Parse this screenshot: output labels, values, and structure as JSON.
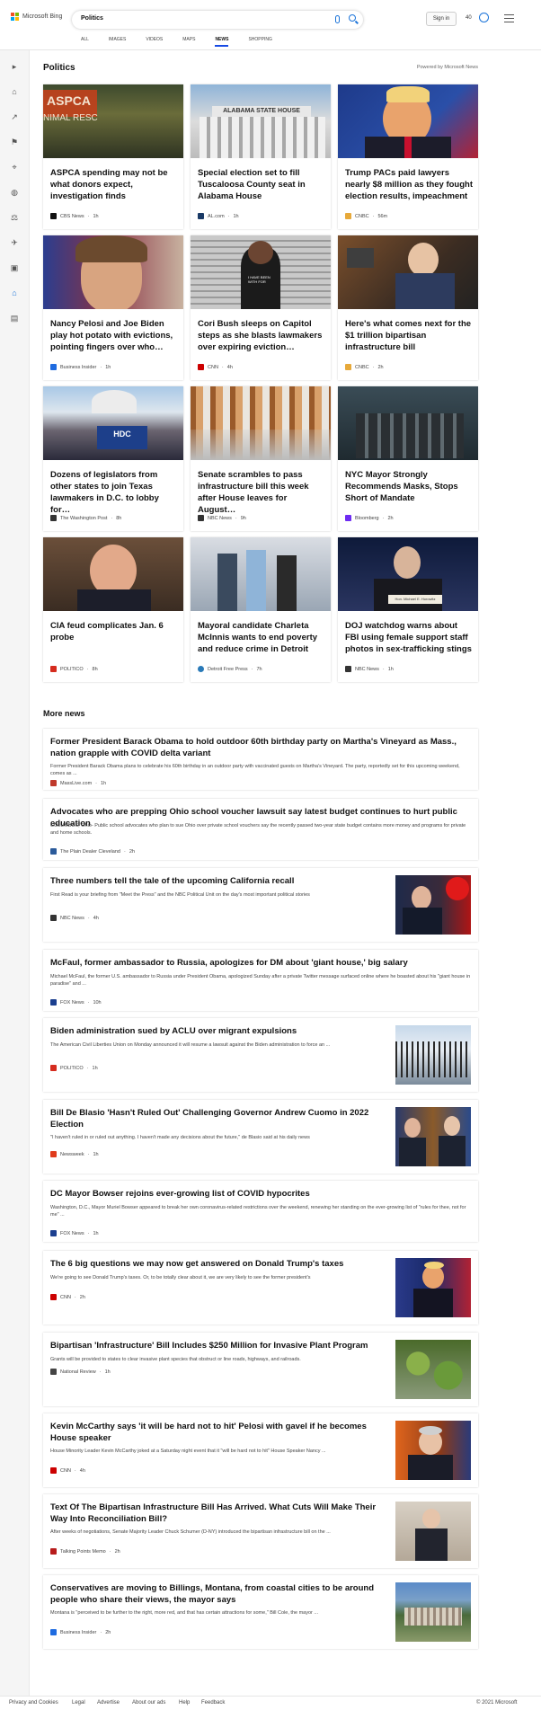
{
  "header": {
    "brand": "Microsoft Bing",
    "query": "Politics",
    "signin": "Sign in",
    "points": "40",
    "tabs": [
      "ALL",
      "IMAGES",
      "VIDEOS",
      "MAPS",
      "NEWS",
      "SHOPPING"
    ],
    "active_tab": "NEWS"
  },
  "section": {
    "title": "Politics",
    "powered": "Powered by Microsoft News"
  },
  "cards": [
    {
      "title": "ASPCA spending may not be what donors expect, investigation finds",
      "source": "CBS News",
      "time": "1h",
      "icon": "#111111"
    },
    {
      "title": "Special election set to fill Tuscaloosa County seat in Alabama House",
      "source": "AL.com",
      "time": "1h",
      "icon": "#1a3a66"
    },
    {
      "title": "Trump PACs paid lawyers nearly $8 million as they fought election results, impeachment",
      "source": "CNBC",
      "time": "56m",
      "icon": "#e7a93a"
    },
    {
      "title": "Nancy Pelosi and Joe Biden play hot potato with evictions, pointing fingers over who…",
      "source": "Business Insider",
      "time": "1h",
      "icon": "#1e6be0"
    },
    {
      "title": "Cori Bush sleeps on Capitol steps as she blasts lawmakers over expiring eviction…",
      "source": "CNN",
      "time": "4h",
      "icon": "#cc0000"
    },
    {
      "title": "Here's what comes next for the $1 trillion bipartisan infrastructure bill",
      "source": "CNBC",
      "time": "2h",
      "icon": "#e7a93a"
    },
    {
      "title": "Dozens of legislators from other states to join Texas lawmakers in D.C. to lobby for…",
      "source": "The Washington Post",
      "time": "8h",
      "icon": "#333333"
    },
    {
      "title": "Senate scrambles to pass infrastructure bill this week after House leaves for August…",
      "source": "NBC News",
      "time": "9h",
      "icon": "#333333"
    },
    {
      "title": "NYC Mayor Strongly Recommends Masks, Stops Short of Mandate",
      "source": "Bloomberg",
      "time": "2h",
      "icon": "#6e2cf2"
    },
    {
      "title": "CIA feud complicates Jan. 6 probe",
      "source": "POLITICO",
      "time": "8h",
      "icon": "#d52b1e"
    },
    {
      "title": "Mayoral candidate Charleta McInnis wants to end poverty and reduce crime in Detroit",
      "source": "Detroit Free Press",
      "time": "7h",
      "icon": "#2a7ab8"
    },
    {
      "title": "DOJ watchdog warns about FBI using female support staff photos in sex-trafficking stings",
      "source": "NBC News",
      "time": "1h",
      "icon": "#333333"
    }
  ],
  "more_news_title": "More news",
  "items": [
    {
      "title": "Former President Barack Obama to hold outdoor 60th birthday party on Martha's Vineyard as Mass., nation grapple with COVID delta variant",
      "snippet": "Former President Barack Obama plans to celebrate his 60th birthday in an outdoor party with vaccinated guests on Martha's Vineyard. The party, reportedly set for this upcoming weekend, comes as ...",
      "source": "MassLive.com",
      "time": "1h",
      "icon": "#c0392b"
    },
    {
      "title": "Advocates who are prepping Ohio school voucher lawsuit say latest budget continues to hurt public education",
      "snippet": "COLUMBUS, Ohio- Public school advocates who plan to sue Ohio over private school vouchers say the recently passed two-year state budget contains more money and programs for private and home schools.",
      "source": "The Plain Dealer Cleveland",
      "time": "2h",
      "icon": "#2a5a9a"
    },
    {
      "title": "Three numbers tell the tale of the upcoming California recall",
      "snippet": "First Read is your briefing from \"Meet the Press\" and the NBC Political Unit on the day's most important political stories",
      "source": "NBC News",
      "time": "4h",
      "icon": "#333333"
    },
    {
      "title": "McFaul, former ambassador to Russia, apologizes for DM about 'giant house,' big salary",
      "snippet": "Michael McFaul, the former U.S. ambassador to Russia under President Obama, apologized Sunday after a private Twitter message surfaced online where he boasted about his \"giant house in paradise\" and ...",
      "source": "FOX News",
      "time": "10h",
      "icon": "#1b3f8f"
    },
    {
      "title": "Biden administration sued by ACLU over migrant expulsions",
      "snippet": "The American Civil Liberties Union on Monday announced it will resume a lawsuit against the Biden administration to force an ...",
      "source": "POLITICO",
      "time": "1h",
      "icon": "#d52b1e"
    },
    {
      "title": "Bill De Blasio 'Hasn't Ruled Out' Challenging Governor Andrew Cuomo in 2022 Election",
      "snippet": "\"I haven't ruled in or ruled out anything. I haven't made any decisions about the future,\" de Blasio said at his daily news",
      "source": "Newsweek",
      "time": "1h",
      "icon": "#e03b1c"
    },
    {
      "title": "DC Mayor Bowser rejoins ever-growing list of COVID hypocrites",
      "snippet": "Washington, D.C., Mayor Muriel Bowser appeared to break her own coronavirus-related restrictions over the weekend, renewing her standing on the ever-growing list of \"rules for thee, not for me\" ...",
      "source": "FOX News",
      "time": "1h",
      "icon": "#1b3f8f"
    },
    {
      "title": "The 6 big questions we may now get answered on Donald Trump's taxes",
      "snippet": "We're going to see Donald Trump's taxes. Or, to be totally clear about it, we are very likely to see the former president's",
      "source": "CNN",
      "time": "2h",
      "icon": "#cc0000"
    },
    {
      "title": "Bipartisan 'Infrastructure' Bill Includes $250 Million for Invasive Plant Program",
      "snippet": "Grants will be provided to states to clear invasive plant species that obstruct or line roads, highways, and railroads.",
      "source": "National Review",
      "time": "1h",
      "icon": "#444444"
    },
    {
      "title": "Kevin McCarthy says 'it will be hard not to hit' Pelosi with gavel if he becomes House speaker",
      "snippet": "House Minority Leader Kevin McCarthy joked at a Saturday night event that it \"will be hard not to hit\" House Speaker Nancy ...",
      "source": "CNN",
      "time": "4h",
      "icon": "#cc0000"
    },
    {
      "title": "Text Of The Bipartisan Infrastructure Bill Has Arrived. What Cuts Will Make Their Way Into Reconciliation Bill?",
      "snippet": "After weeks of negotiations, Senate Majority Leader Chuck Schumer (D-NY) introduced the bipartisan infrastructure bill on the ...",
      "source": "Talking Points Memo",
      "time": "2h",
      "icon": "#b71c1c"
    },
    {
      "title": "Conservatives are moving to Billings, Montana, from coastal cities to be around people who share their views, the mayor says",
      "snippet": "Montana is \"perceived to be further to the right, more red, and that has certain attractions for some,\" Bill Cole, the mayor ...",
      "source": "Business Insider",
      "time": "2h",
      "icon": "#1e6be0"
    }
  ],
  "footer": {
    "links": [
      "Privacy and Cookies",
      "Legal",
      "Advertise",
      "About our ads",
      "Help",
      "Feedback"
    ],
    "copyright": "© 2021 Microsoft"
  }
}
